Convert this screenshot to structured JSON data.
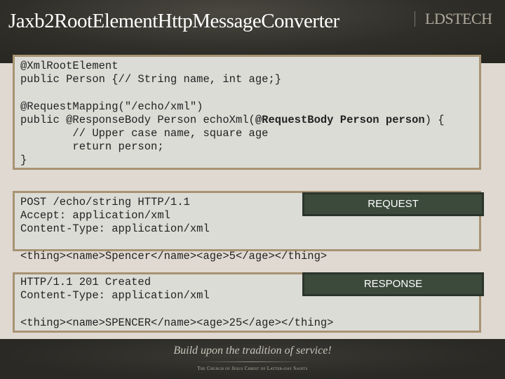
{
  "header": {
    "title": "Jaxb2RootElementHttpMessageConverter",
    "logo": "LDSTECH"
  },
  "code_block": {
    "line1": "@XmlRootElement",
    "line2": "public Person {// String name, int age;}",
    "line3": "@RequestMapping(\"/echo/xml\")",
    "line4_start": "public @ResponseBody Person echoXml(",
    "line4_bold": "@RequestBody Person person",
    "line4_end": ") {",
    "line5": "        // Upper case name, square age",
    "line6": "        return person;",
    "line7": "}"
  },
  "request": {
    "label": "REQUEST",
    "line1": "POST /echo/string HTTP/1.1",
    "line2": "Accept: application/xml",
    "line3": "Content-Type: application/xml",
    "body": "<thing><name>Spencer</name><age>5</age></thing>"
  },
  "response": {
    "label": "RESPONSE",
    "line1": "HTTP/1.1 201 Created",
    "line2": "Content-Type: application/xml",
    "body": "<thing><name>SPENCER</name><age>25</age></thing>"
  },
  "footer": {
    "tagline": "Build upon the tradition of service!",
    "church": "The Church of Jesus Christ of Latter-day Saints"
  }
}
